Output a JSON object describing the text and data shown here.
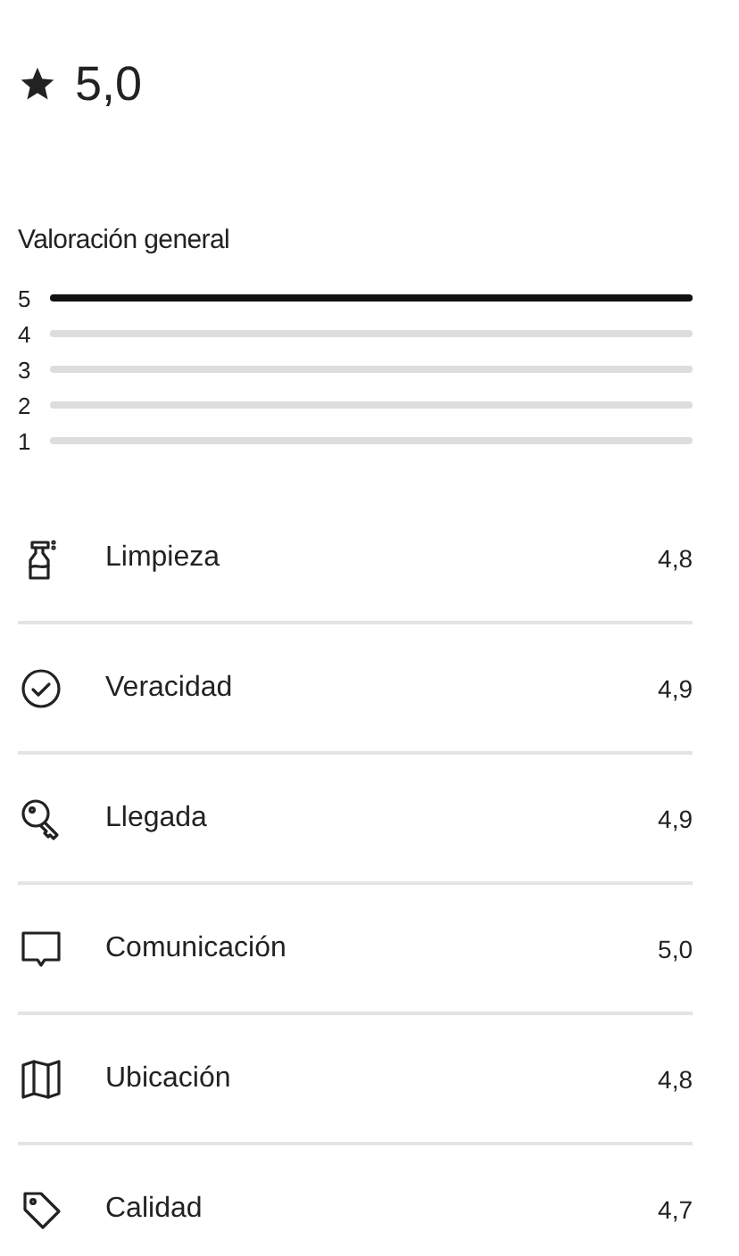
{
  "overall": {
    "rating": "5,0"
  },
  "distribution": {
    "title": "Valoración general",
    "bars": [
      {
        "label": "5",
        "level": 1.0
      },
      {
        "label": "4",
        "level": 0
      },
      {
        "label": "3",
        "level": 0
      },
      {
        "label": "2",
        "level": 0
      },
      {
        "label": "1",
        "level": 0
      }
    ]
  },
  "categories": [
    {
      "label": "Limpieza",
      "score": "4,8"
    },
    {
      "label": "Veracidad",
      "score": "4,9"
    },
    {
      "label": "Llegada",
      "score": "4,9"
    },
    {
      "label": "Comunicación",
      "score": "5,0"
    },
    {
      "label": "Ubicación",
      "score": "4,8"
    },
    {
      "label": "Calidad",
      "score": "4,7"
    }
  ]
}
